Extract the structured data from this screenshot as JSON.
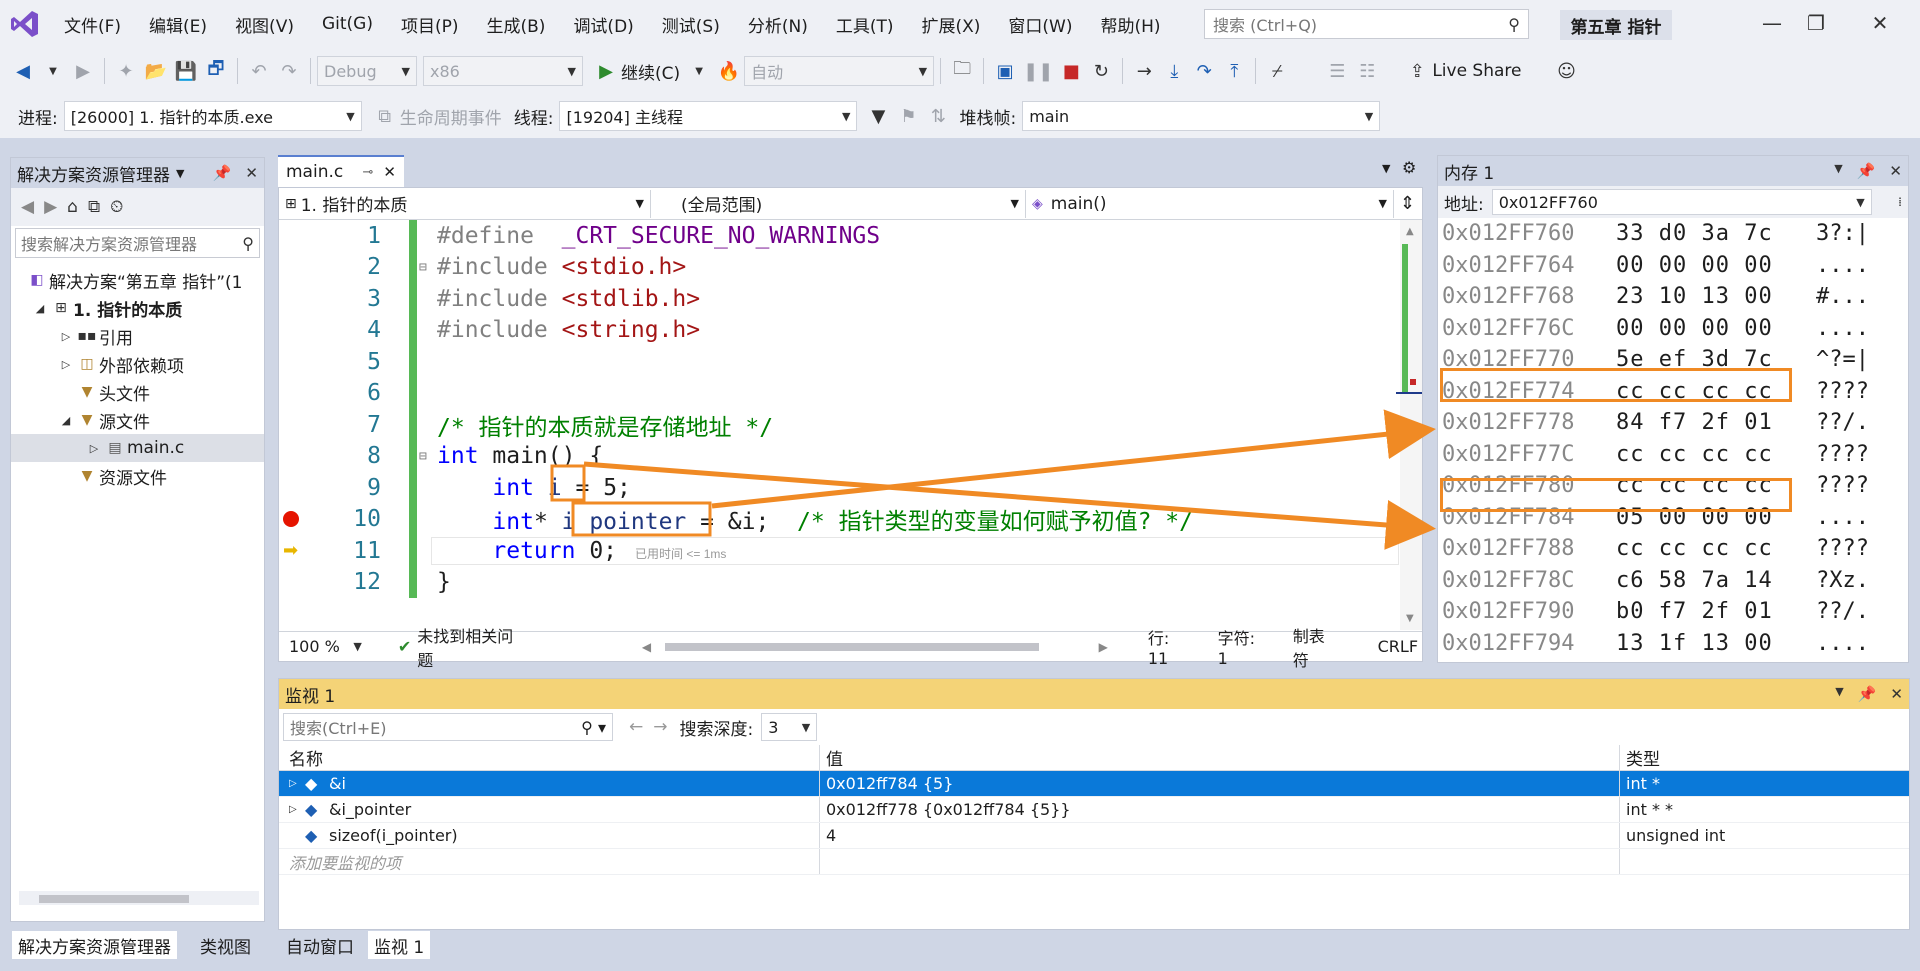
{
  "menu": [
    "文件(F)",
    "编辑(E)",
    "视图(V)",
    "Git(G)",
    "项目(P)",
    "生成(B)",
    "调试(D)",
    "测试(S)",
    "分析(N)",
    "工具(T)",
    "扩展(X)",
    "窗口(W)",
    "帮助(H)"
  ],
  "search": {
    "placeholder": "搜索 (Ctrl+Q)"
  },
  "solution_title": "第五章 指针",
  "toolbar1": {
    "config": "Debug",
    "platform": "x86",
    "continue_label": "继续(C)",
    "auto_label": "自动",
    "live_share": "Live Share"
  },
  "toolbar2": {
    "process_label": "进程:",
    "process_value": "[26000] 1. 指针的本质.exe",
    "lifecycle_label": "生命周期事件",
    "thread_label": "线程:",
    "thread_value": "[19204] 主线程",
    "stack_label": "堆栈帧:",
    "stack_value": "main"
  },
  "solution_explorer": {
    "title": "解决方案资源管理器",
    "search_placeholder": "搜索解决方案资源管理器",
    "items": [
      {
        "label": "解决方案“第五章 指针”(1"
      },
      {
        "label": "1. 指针的本质"
      },
      {
        "label": "引用"
      },
      {
        "label": "外部依赖项"
      },
      {
        "label": "头文件"
      },
      {
        "label": "源文件"
      },
      {
        "label": "main.c"
      },
      {
        "label": "资源文件"
      }
    ],
    "tab1": "解决方案资源管理器",
    "tab2": "类视图"
  },
  "editor": {
    "tab_label": "main.c",
    "nav_project": "1. 指针的本质",
    "nav_scope": "(全局范围)",
    "nav_func": "main()",
    "elapsed": "已用时间 <= 1ms",
    "zoom": "100 %",
    "issues": "未找到相关问题",
    "row": "行: 11",
    "col": "字符: 1",
    "tabs": "制表符",
    "eol": "CRLF",
    "lines": [
      {
        "n": "1",
        "parts": [
          {
            "t": "#define  ",
            "c": "pp"
          },
          {
            "t": "_CRT_SECURE_NO_WARNINGS",
            "c": "mac"
          }
        ]
      },
      {
        "n": "2",
        "parts": [
          {
            "t": "#include ",
            "c": "pp"
          },
          {
            "t": "<stdio.h>",
            "c": "str"
          }
        ]
      },
      {
        "n": "3",
        "parts": [
          {
            "t": "#include ",
            "c": "pp"
          },
          {
            "t": "<stdlib.h>",
            "c": "str"
          }
        ]
      },
      {
        "n": "4",
        "parts": [
          {
            "t": "#include ",
            "c": "pp"
          },
          {
            "t": "<string.h>",
            "c": "str"
          }
        ]
      },
      {
        "n": "5",
        "parts": []
      },
      {
        "n": "6",
        "parts": []
      },
      {
        "n": "7",
        "parts": [
          {
            "t": "/* 指针的本质就是存储地址 */",
            "c": "cm"
          }
        ]
      },
      {
        "n": "8",
        "parts": [
          {
            "t": "int",
            "c": "kw"
          },
          {
            "t": " main() {",
            "c": ""
          }
        ]
      },
      {
        "n": "9",
        "parts": [
          {
            "t": "    int",
            "c": "kw"
          },
          {
            "t": " ",
            "c": ""
          },
          {
            "t": "i",
            "c": "var"
          },
          {
            "t": " = 5;",
            "c": ""
          }
        ]
      },
      {
        "n": "10",
        "parts": [
          {
            "t": "    int",
            "c": "kw"
          },
          {
            "t": "* ",
            "c": ""
          },
          {
            "t": "i_pointer",
            "c": "var"
          },
          {
            "t": " = &i;  ",
            "c": ""
          },
          {
            "t": "/* 指针类型的变量如何赋予初值? */",
            "c": "cm"
          }
        ]
      },
      {
        "n": "11",
        "parts": [
          {
            "t": "    return",
            "c": "kw"
          },
          {
            "t": " 0;",
            "c": ""
          }
        ]
      },
      {
        "n": "12",
        "parts": [
          {
            "t": "}",
            "c": ""
          }
        ]
      }
    ]
  },
  "memory": {
    "title": "内存 1",
    "addr_label": "地址:",
    "addr_value": "0x012FF760",
    "rows": [
      {
        "a": "0x012FF760",
        "b": "33 d0 3a 7c",
        "c": "3?:|"
      },
      {
        "a": "0x012FF764",
        "b": "00 00 00 00",
        "c": "...."
      },
      {
        "a": "0x012FF768",
        "b": "23 10 13 00",
        "c": "#..."
      },
      {
        "a": "0x012FF76C",
        "b": "00 00 00 00",
        "c": "...."
      },
      {
        "a": "0x012FF770",
        "b": "5e ef 3d 7c",
        "c": "^?=|"
      },
      {
        "a": "0x012FF774",
        "b": "cc cc cc cc",
        "c": "????"
      },
      {
        "a": "0x012FF778",
        "b": "84 f7 2f 01",
        "c": "??/."
      },
      {
        "a": "0x012FF77C",
        "b": "cc cc cc cc",
        "c": "????"
      },
      {
        "a": "0x012FF780",
        "b": "cc cc cc cc",
        "c": "????"
      },
      {
        "a": "0x012FF784",
        "b": "05 00 00 00",
        "c": "...."
      },
      {
        "a": "0x012FF788",
        "b": "cc cc cc cc",
        "c": "????"
      },
      {
        "a": "0x012FF78C",
        "b": "c6 58 7a 14",
        "c": "?Xz."
      },
      {
        "a": "0x012FF790",
        "b": "b0 f7 2f 01",
        "c": "??/."
      },
      {
        "a": "0x012FF794",
        "b": "13 1f 13 00",
        "c": "...."
      }
    ]
  },
  "watch": {
    "title": "监视 1",
    "search_placeholder": "搜索(Ctrl+E)",
    "depth_label": "搜索深度:",
    "depth_value": "3",
    "col_name": "名称",
    "col_value": "值",
    "col_type": "类型",
    "rows": [
      {
        "name": "&i",
        "value": "0x012ff784 {5}",
        "type": "int *"
      },
      {
        "name": "&i_pointer",
        "value": "0x012ff778 {0x012ff784 {5}}",
        "type": "int * *"
      },
      {
        "name": "sizeof(i_pointer)",
        "value": "4",
        "type": "unsigned int"
      }
    ],
    "add_hint": "添加要监视的项",
    "tab1": "自动窗口",
    "tab2": "监视 1"
  }
}
